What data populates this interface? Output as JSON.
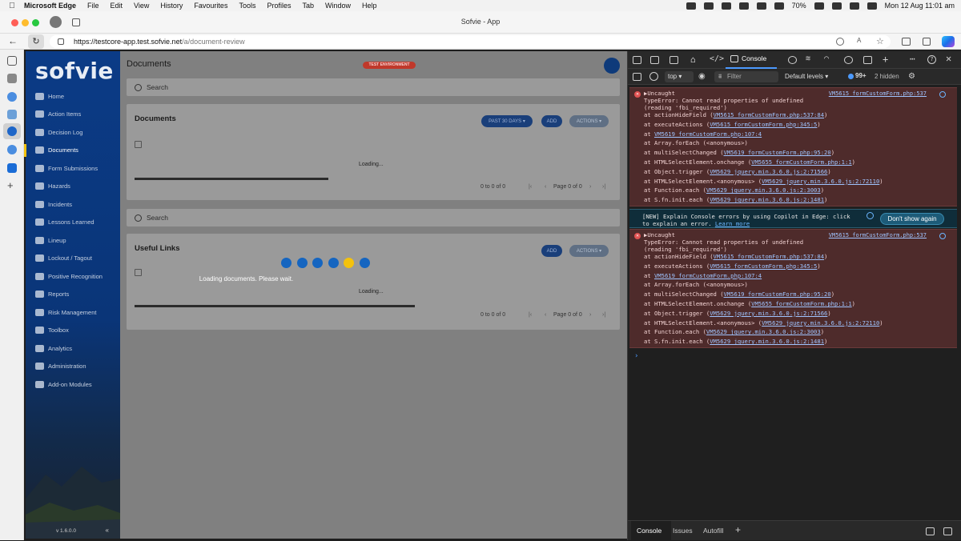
{
  "menubar": {
    "app": "Microsoft Edge",
    "items": [
      "File",
      "Edit",
      "View",
      "History",
      "Favourites",
      "Tools",
      "Profiles",
      "Tab",
      "Window",
      "Help"
    ],
    "battery": "70%",
    "clock": "Mon 12 Aug  11:01 am"
  },
  "browser": {
    "tab_title": "Sofvie - App",
    "url_host": "https://testcore-app.test.sofvie.net",
    "url_path": "/a/document-review"
  },
  "sidebar": {
    "logo": "sofvie",
    "items": [
      "Home",
      "Action Items",
      "Decision Log",
      "Documents",
      "Form Submissions",
      "Hazards",
      "Incidents",
      "Lessons Learned",
      "Lineup",
      "Lockout / Tagout",
      "Positive Recognition",
      "Reports",
      "Risk Management",
      "Toolbox",
      "Analytics",
      "Administration",
      "Add-on Modules"
    ],
    "active_index": 3,
    "version": "v 1.6.0.0",
    "collapse": "«"
  },
  "main": {
    "page_title": "Documents",
    "env_badge": "TEST ENVIRONMENT",
    "search_placeholder_1": "Search",
    "search_placeholder_2": "Search",
    "documents_card": {
      "title": "Documents",
      "filter_button": "PAST 30 DAYS ▾",
      "add_button": "ADD",
      "actions_button": "ACTIONS ▾",
      "loading": "Loading...",
      "range": "0 to 0 of 0",
      "page": "Page 0 of 0"
    },
    "links_card": {
      "title": "Useful Links",
      "add_button": "ADD",
      "actions_button": "ACTIONS ▾",
      "loading": "Loading...",
      "range": "0 to 0 of 0",
      "page": "Page 0 of 0"
    },
    "overlay_message": "Loading documents. Please wait.",
    "overlay_active_dot": 4
  },
  "devtools": {
    "console_tab": "Console",
    "context": "top ▾",
    "filter_placeholder": "Filter",
    "levels": "Default levels ▾",
    "issues": "99+",
    "hidden": "2 hidden",
    "errors": [
      {
        "source": "VM5615 formCustomForm.php:537",
        "lines": [
          "▶Uncaught",
          "TypeError: Cannot read properties of undefined",
          "(reading 'fbi_required')"
        ],
        "stack": [
          {
            "fn": "    at actionHideField (",
            "link": "VM5615 formCustomForm.php:537:84",
            "end": ")"
          },
          {
            "fn": "    at executeActions (",
            "link": "VM5615 formCustomForm.php:345:5",
            "end": ")"
          },
          {
            "fn": "    at ",
            "link": "VM5619 formCustomForm.php:107:4",
            "end": ""
          },
          {
            "fn": "    at Array.forEach (<anonymous>)",
            "link": "",
            "end": ""
          },
          {
            "fn": "    at multiSelectChanged (",
            "link": "VM5619 formCustomForm.php:95:20",
            "end": ")"
          },
          {
            "fn": "    at HTMLSelectElement.onchange (",
            "link": "VM5655 formCustomForm.php:1:1",
            "end": ")"
          },
          {
            "fn": "    at Object.trigger (",
            "link": "VM5629 jquery.min.3.6.0.js:2:71566",
            "end": ")"
          },
          {
            "fn": "    at HTMLSelectElement.<anonymous> (",
            "link": "VM5629 jquery.min.3.6.0.js:2:72110",
            "end": ")"
          },
          {
            "fn": "    at Function.each (",
            "link": "VM5629 jquery.min.3.6.0.js:2:3003",
            "end": ")"
          },
          {
            "fn": "    at S.fn.init.each (",
            "link": "VM5629 jquery.min.3.6.0.js:2:1481",
            "end": ")"
          }
        ]
      },
      {
        "source": "VM5615 formCustomForm.php:537",
        "lines": [
          "▶Uncaught",
          "TypeError: Cannot read properties of undefined",
          "(reading 'fbi_required')"
        ],
        "stack": [
          {
            "fn": "    at actionHideField (",
            "link": "VM5615 formCustomForm.php:537:84",
            "end": ")"
          },
          {
            "fn": "    at executeActions (",
            "link": "VM5615 formCustomForm.php:345:5",
            "end": ")"
          },
          {
            "fn": "    at ",
            "link": "VM5619 formCustomForm.php:107:4",
            "end": ""
          },
          {
            "fn": "    at Array.forEach (<anonymous>)",
            "link": "",
            "end": ""
          },
          {
            "fn": "    at multiSelectChanged (",
            "link": "VM5619 formCustomForm.php:95:20",
            "end": ")"
          },
          {
            "fn": "    at HTMLSelectElement.onchange (",
            "link": "VM5655 formCustomForm.php:1:1",
            "end": ")"
          },
          {
            "fn": "    at Object.trigger (",
            "link": "VM5629 jquery.min.3.6.0.js:2:71566",
            "end": ")"
          },
          {
            "fn": "    at HTMLSelectElement.<anonymous> (",
            "link": "VM5629 jquery.min.3.6.0.js:2:72110",
            "end": ")"
          },
          {
            "fn": "    at Function.each (",
            "link": "VM5629 jquery.min.3.6.0.js:2:3003",
            "end": ")"
          },
          {
            "fn": "    at S.fn.init.each (",
            "link": "VM5629 jquery.min.3.6.0.js:2:1481",
            "end": ")"
          }
        ]
      }
    ],
    "copilot_text": "[NEW] Explain Console errors by using Copilot in Edge: click",
    "copilot_text2": "to explain an error.",
    "copilot_link": "Learn more",
    "dont_show": "Don't show again",
    "prompt": "›",
    "drawer_tabs": [
      "Console",
      "Issues",
      "Autofill"
    ],
    "drawer_add": "+"
  },
  "colors": {
    "sidebar": "#0b3b86",
    "accent": "#1565c0",
    "active_dot": "#f4c20d",
    "error_bg": "#4e2b2b"
  }
}
